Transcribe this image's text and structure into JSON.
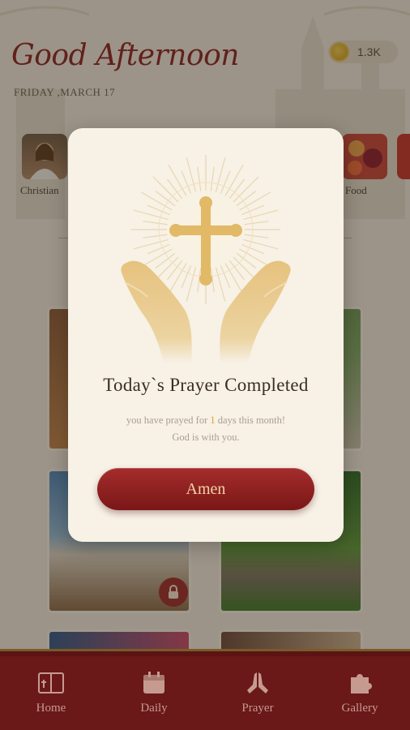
{
  "header": {
    "greeting": "Good Afternoon",
    "date": "FRIDAY ,MARCH 17",
    "coins": "1.3K"
  },
  "categories": [
    {
      "label": "Christian",
      "icon": "jesus-portrait"
    },
    {
      "label": "Food",
      "icon": "food-plate"
    }
  ],
  "modal": {
    "title": "Today`s Prayer Completed",
    "sub_prefix": "you have prayed for ",
    "days": "1",
    "sub_suffix": " days this month!",
    "sub_line2": "God is with you.",
    "button": "Amen",
    "hero_icon": "praying-hands-cross-icon"
  },
  "nav": {
    "items": [
      {
        "label": "Home",
        "icon": "bible-icon"
      },
      {
        "label": "Daily",
        "icon": "calendar-icon"
      },
      {
        "label": "Prayer",
        "icon": "praying-hands-icon"
      },
      {
        "label": "Gallery",
        "icon": "puzzle-icon"
      }
    ]
  },
  "colors": {
    "accent": "#8b2424",
    "gold": "#d9a72c",
    "nav_bg": "#6a1818"
  }
}
